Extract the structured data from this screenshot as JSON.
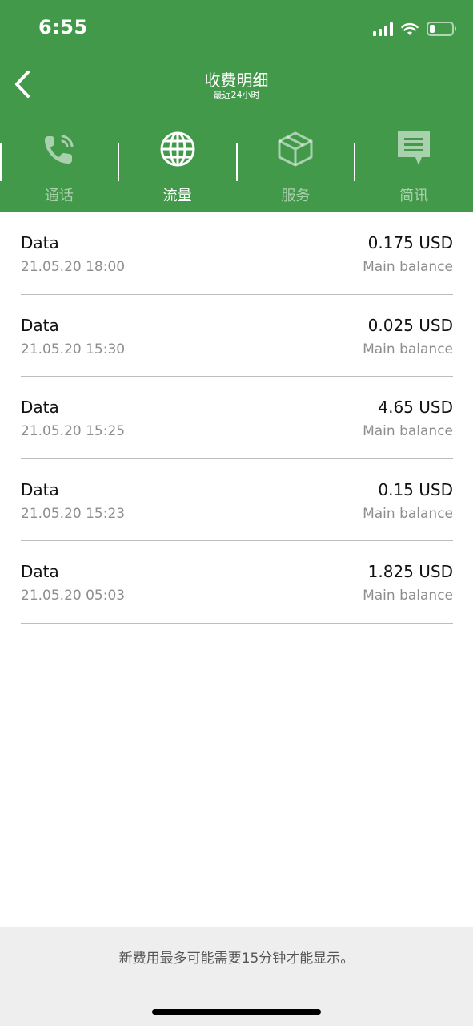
{
  "status_bar": {
    "time": "6:55"
  },
  "nav": {
    "title": "收费明细",
    "subtitle": "最近24小时"
  },
  "tabs": [
    {
      "label": "通话",
      "icon": "phone-icon",
      "active": false
    },
    {
      "label": "流量",
      "icon": "globe-icon",
      "active": true
    },
    {
      "label": "服务",
      "icon": "box-icon",
      "active": false
    },
    {
      "label": "简讯",
      "icon": "message-icon",
      "active": false
    }
  ],
  "charges": [
    {
      "type": "Data",
      "date": "21.05.20 18:00",
      "amount": "0.175 USD",
      "balance": "Main balance"
    },
    {
      "type": "Data",
      "date": "21.05.20 15:30",
      "amount": "0.025 USD",
      "balance": "Main balance"
    },
    {
      "type": "Data",
      "date": "21.05.20 15:25",
      "amount": "4.65 USD",
      "balance": "Main balance"
    },
    {
      "type": "Data",
      "date": "21.05.20 15:23",
      "amount": "0.15 USD",
      "balance": "Main balance"
    },
    {
      "type": "Data",
      "date": "21.05.20 05:03",
      "amount": "1.825 USD",
      "balance": "Main balance"
    }
  ],
  "footer": {
    "note": "新费用最多可能需要15分钟才能显示。"
  },
  "colors": {
    "header_green": "#43994a",
    "secondary_text": "#8e8e8e",
    "divider": "#bdbdbd"
  }
}
